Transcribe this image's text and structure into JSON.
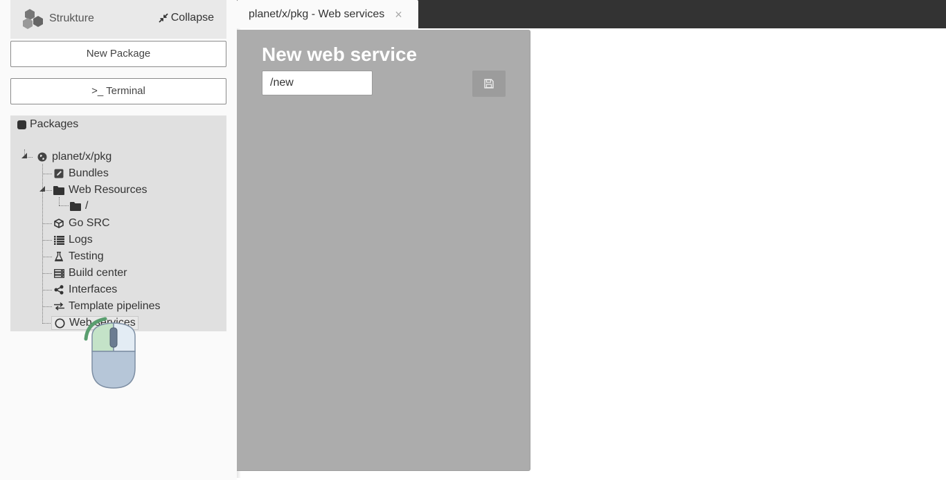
{
  "sidebar": {
    "brand": "Strukture",
    "collapse_label": "Collapse",
    "new_package_label": "New Package",
    "terminal_label": ">_ Terminal",
    "packages_title": "Packages",
    "tree": {
      "root": "planet/x/pkg",
      "items": {
        "bundles": "Bundles",
        "web_resources": "Web Resources",
        "web_resources_child": "/",
        "go_src": "Go SRC",
        "logs": "Logs",
        "testing": "Testing",
        "build_center": "Build center",
        "interfaces": "Interfaces",
        "template_pipelines": "Template pipelines",
        "web_services": "Web services"
      },
      "selected": "web_services"
    }
  },
  "tabs": [
    {
      "label": "planet/x/pkg - Web services",
      "close": "×",
      "active": true
    }
  ],
  "panel": {
    "title": "New web service",
    "path_value": "/new",
    "save_icon": "floppy-disk-icon"
  },
  "colors": {
    "topbar": "#333333",
    "panel_bg": "#acacac",
    "sidebar_panel": "#e0e0e0",
    "mouse_highlight": "#5a9e6f"
  },
  "cursor": {
    "type": "mouse-left-click-indicator"
  }
}
